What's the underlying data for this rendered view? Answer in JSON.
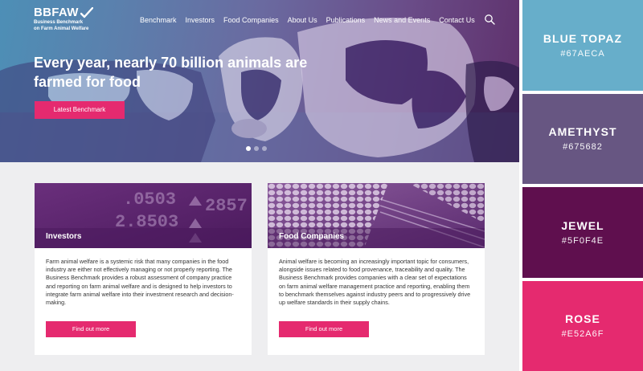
{
  "site": {
    "logo": {
      "mark": "BBFAW",
      "sub_line1": "Business Benchmark",
      "sub_line2": "on Farm Animal Welfare"
    },
    "nav": [
      "Benchmark",
      "Investors",
      "Food Companies",
      "About Us",
      "Publications",
      "News and Events",
      "Contact Us"
    ],
    "hero": {
      "title": "Every year, nearly 70 billion animals are farmed for food",
      "button": "Latest Benchmark",
      "slides_total": 3,
      "slide_active": 1
    },
    "cards": [
      {
        "title": "Investors",
        "text": "Farm animal welfare is a systemic risk that many companies in the food industry are either not effectively managing or not properly reporting. The Business Benchmark provides a robust assessment of company practice and reporting on farm animal welfare and is designed to help investors to integrate farm animal welfare into their investment research and decision-making.",
        "button": "Find out more"
      },
      {
        "title": "Food Companies",
        "text": "Animal welfare is becoming an increasingly important topic for consumers, alongside issues related to food provenance, traceability and quality. The Business Benchmark provides companies with a clear set of expectations on farm animal welfare management practice and reporting, enabling them to benchmark themselves against industry peers and to progressively drive up welfare standards in their supply chains.",
        "button": "Find out more"
      }
    ],
    "ticker_digits": [
      ".0503",
      "2.8503",
      "2857"
    ]
  },
  "palette": [
    {
      "name": "BLUE TOPAZ",
      "hex": "#67AECA"
    },
    {
      "name": "AMETHYST",
      "hex": "#675682"
    },
    {
      "name": "JEWEL",
      "hex": "#5F0F4E"
    },
    {
      "name": "ROSE",
      "hex": "#E52A6F"
    }
  ]
}
